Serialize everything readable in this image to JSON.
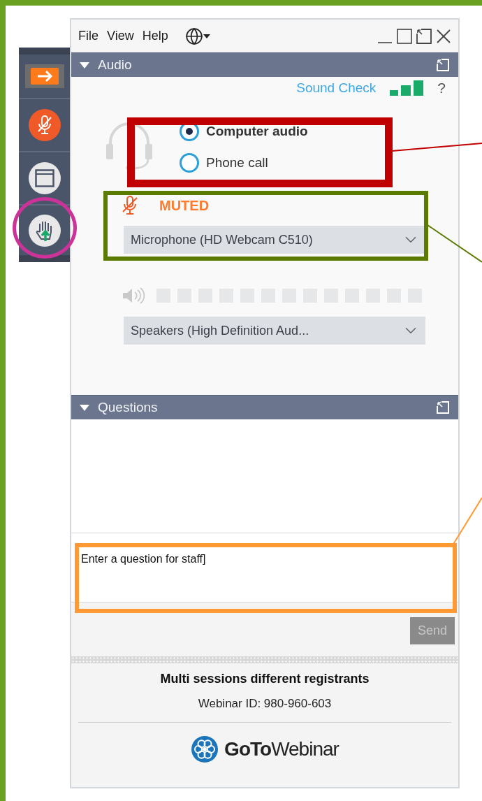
{
  "menu": [
    "File",
    "View",
    "Help"
  ],
  "audio": {
    "title": "Audio",
    "expanded": true,
    "sound_check": "Sound Check",
    "help": "?",
    "modes": [
      {
        "label": "Computer audio",
        "selected": true
      },
      {
        "label": "Phone call",
        "selected": false
      }
    ],
    "mute_status": "MUTED",
    "microphone": "Microphone (HD Webcam C510)",
    "speaker_meter": {
      "level": 0
    },
    "speaker": "Speakers (High Definition Aud..."
  },
  "questions": {
    "title": "Questions",
    "expanded": true,
    "input_value": "Enter a question for staff]",
    "send": {
      "label": "Send",
      "disabled": true
    }
  },
  "footer": {
    "title": "Multi sessions different registrants",
    "webinar_id": "Webinar ID: 980-960-603",
    "logo": "**GoTo**Webinar"
  },
  "annotations": [
    {
      "kind": "box",
      "color": "#c00000"
    },
    {
      "kind": "box",
      "color": "#5b7a00"
    },
    {
      "kind": "box",
      "color": "#ff9933"
    },
    {
      "kind": "circle",
      "color": "#cc3399"
    }
  ]
}
